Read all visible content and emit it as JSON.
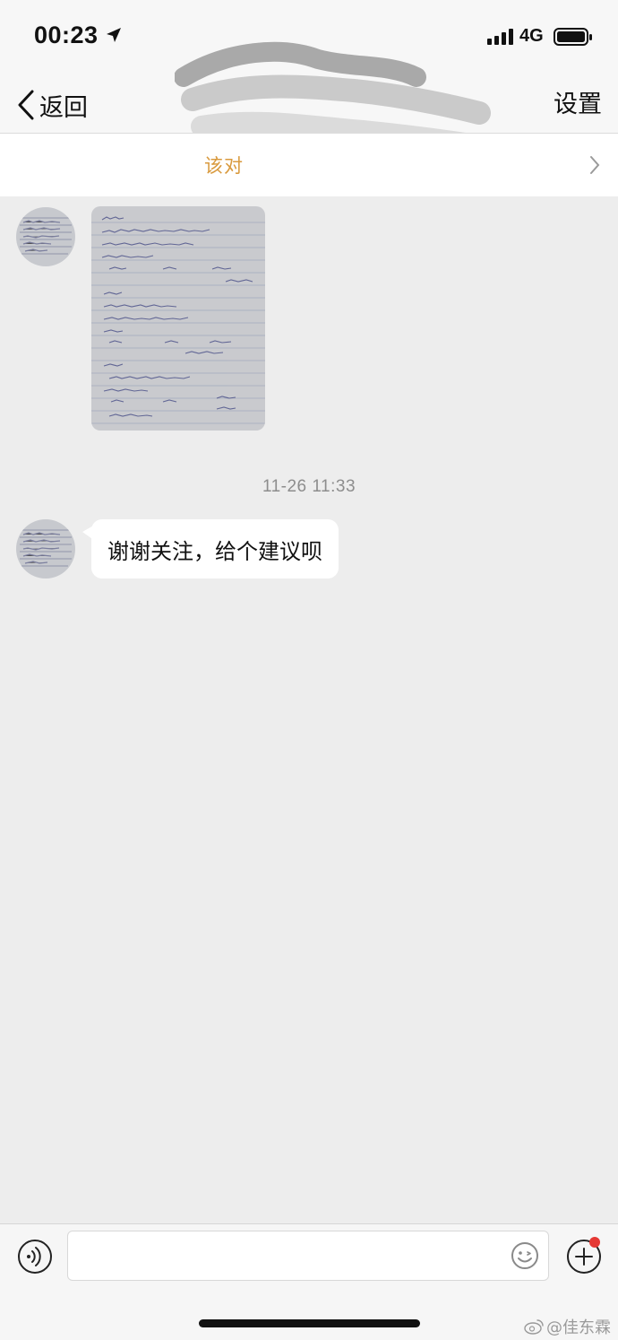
{
  "status_bar": {
    "time": "00:23",
    "network": "4G"
  },
  "nav": {
    "back_label": "返回",
    "settings_label": "设置"
  },
  "banner": {
    "text": "该对"
  },
  "chat": {
    "timestamp": "11-26 11:33",
    "messages": [
      {
        "type": "image",
        "icon": "handwritten-notes-photo"
      },
      {
        "type": "text",
        "text": "谢谢关注，给个建议呗"
      }
    ]
  },
  "input_bar": {
    "placeholder": "",
    "value": ""
  },
  "watermark": {
    "text": "@佳东霖"
  },
  "colors": {
    "background": "#ededed",
    "banner_text": "#d99a3e",
    "notification_dot": "#e53935"
  }
}
